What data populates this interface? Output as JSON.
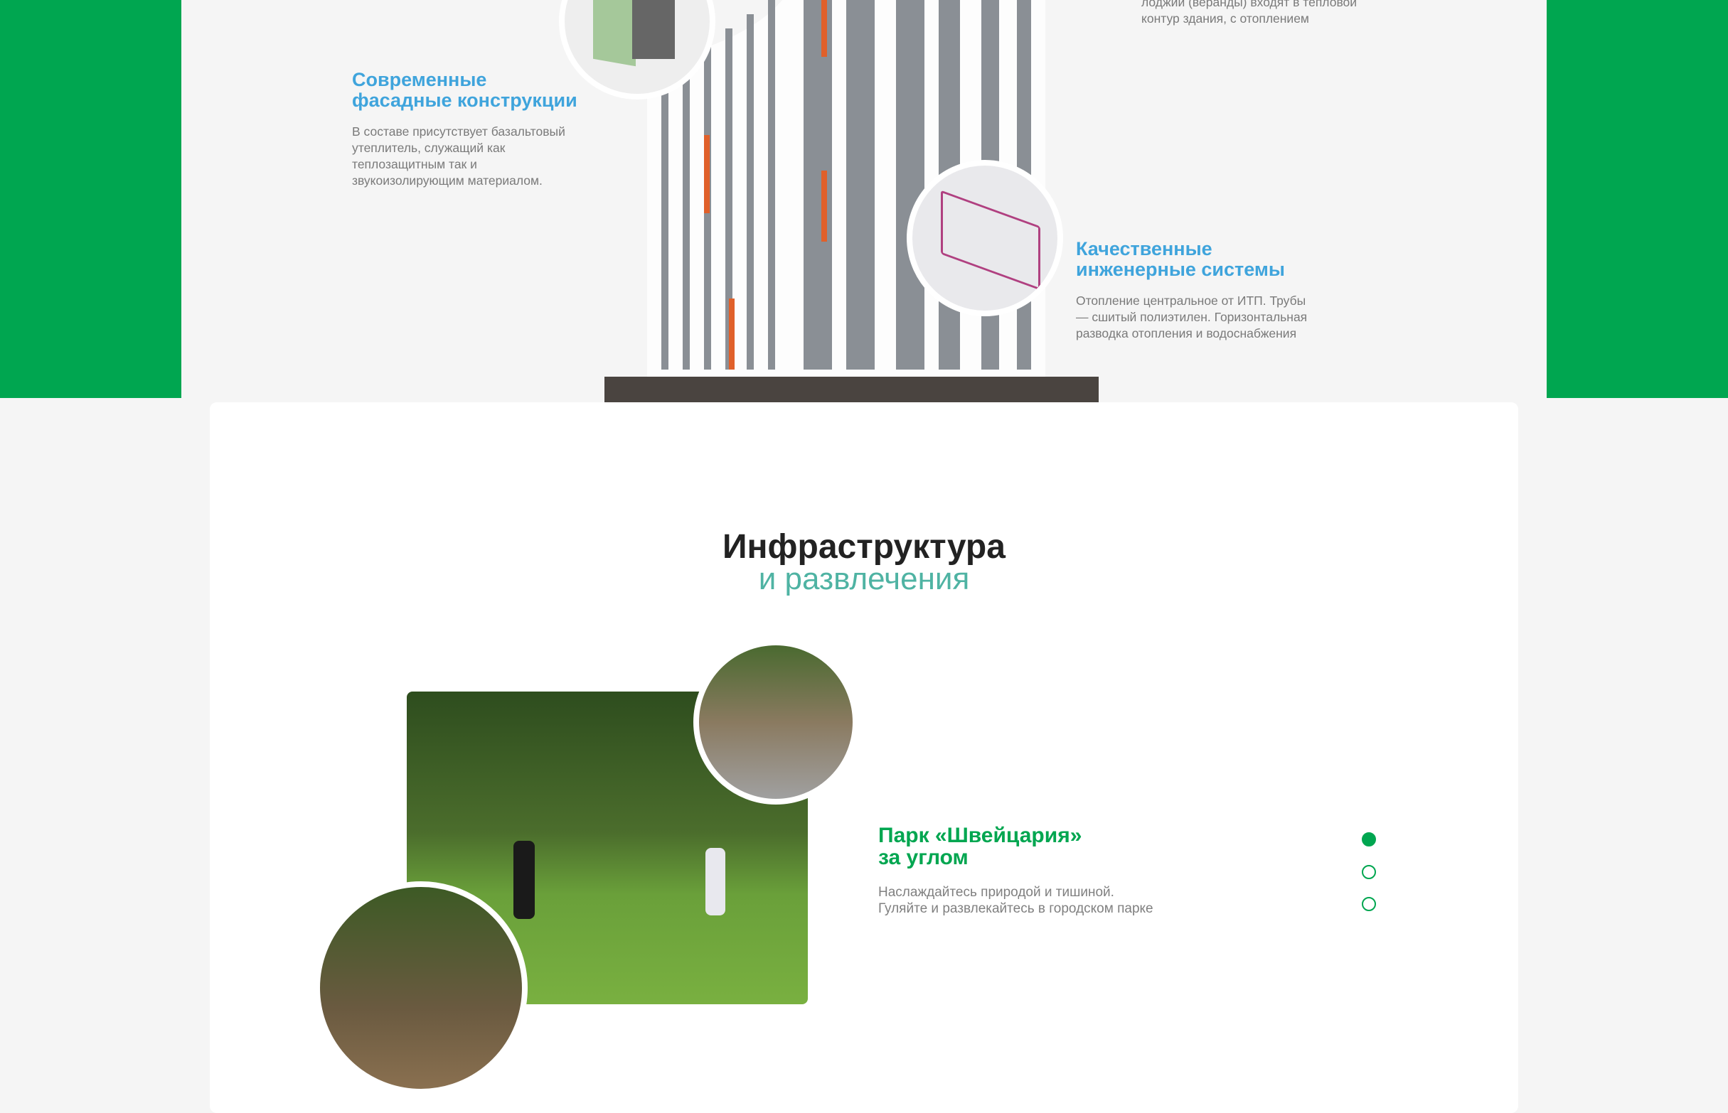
{
  "features": {
    "loggia": {
      "body": "лоджии (веранды) входят в тепловой контур здания, с отоплением"
    },
    "facade": {
      "title_line1": "Современные",
      "title_line2": "фасадные конструкции",
      "body": "В составе присутствует базальтовый утеплитель, служащий как теплозащитным так и звукоизолирующим материалом."
    },
    "engineering": {
      "title_line1": "Качественные",
      "title_line2": "инженерные системы",
      "body": "Отопление центральное от ИТП. Трубы — сшитый полиэтилен. Горизонтальная разводка отопления и водоснабжения"
    }
  },
  "infrastructure": {
    "heading_line1": "Инфраструктура",
    "heading_line2": "и развлечения",
    "slide": {
      "title_line1": "Парк «Швейцария»",
      "title_line2": "за углом",
      "body_line1": "Наслаждайтесь природой и тишиной.",
      "body_line2": "Гуляйте и развлекайтесь в городском парке"
    },
    "active_slide": 1,
    "slide_count": 3
  },
  "colors": {
    "brand_green": "#00a650",
    "blue": "#3fa4dc",
    "teal": "#4fb3a3"
  }
}
